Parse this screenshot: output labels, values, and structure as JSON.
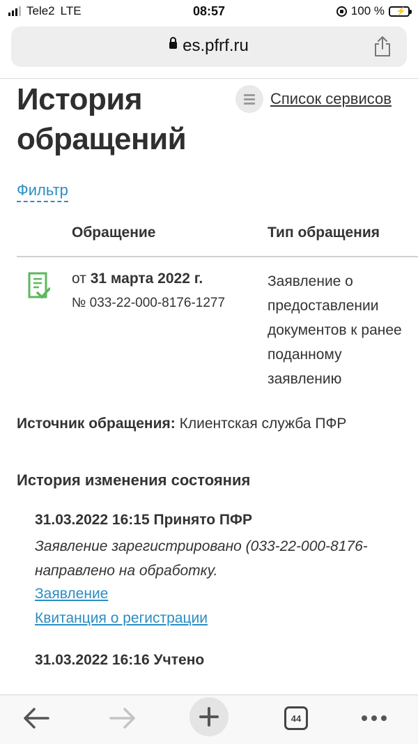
{
  "status_bar": {
    "carrier": "Tele2",
    "network": "LTE",
    "time": "08:57",
    "battery": "100 %"
  },
  "browser": {
    "url": "es.pfrf.ru",
    "tabs_count": "44"
  },
  "page": {
    "title_line1": "История",
    "title_line2": "обращений",
    "services_link": "Список сервисов",
    "filter_link": "Фильтр",
    "table": {
      "col_request": "Обращение",
      "col_type": "Тип обращения",
      "rows": [
        {
          "date_prefix": "от",
          "date": "31 марта 2022 г.",
          "number": "№ 033-22-000-8176-1277",
          "type": "Заявление о предоставлении документов к ранее поданному заявлению"
        }
      ]
    },
    "source_label": "Источник обращения:",
    "source_value": "Клиентская служба ПФР",
    "history_title": "История изменения состояния",
    "events": [
      {
        "title": "31.03.2022 16:15 Принято ПФР",
        "desc_line1": "Заявление зарегистрировано (033-22-000-8176-",
        "desc_line2": "направлено на обработку.",
        "link1": "Заявление",
        "link2": "Квитанция о регистрации"
      },
      {
        "title": "31.03.2022 16:16 Учтено"
      }
    ]
  },
  "colors": {
    "link": "#2b8dc3",
    "doc_icon": "#5cb85c",
    "battery": "#4cd964"
  }
}
